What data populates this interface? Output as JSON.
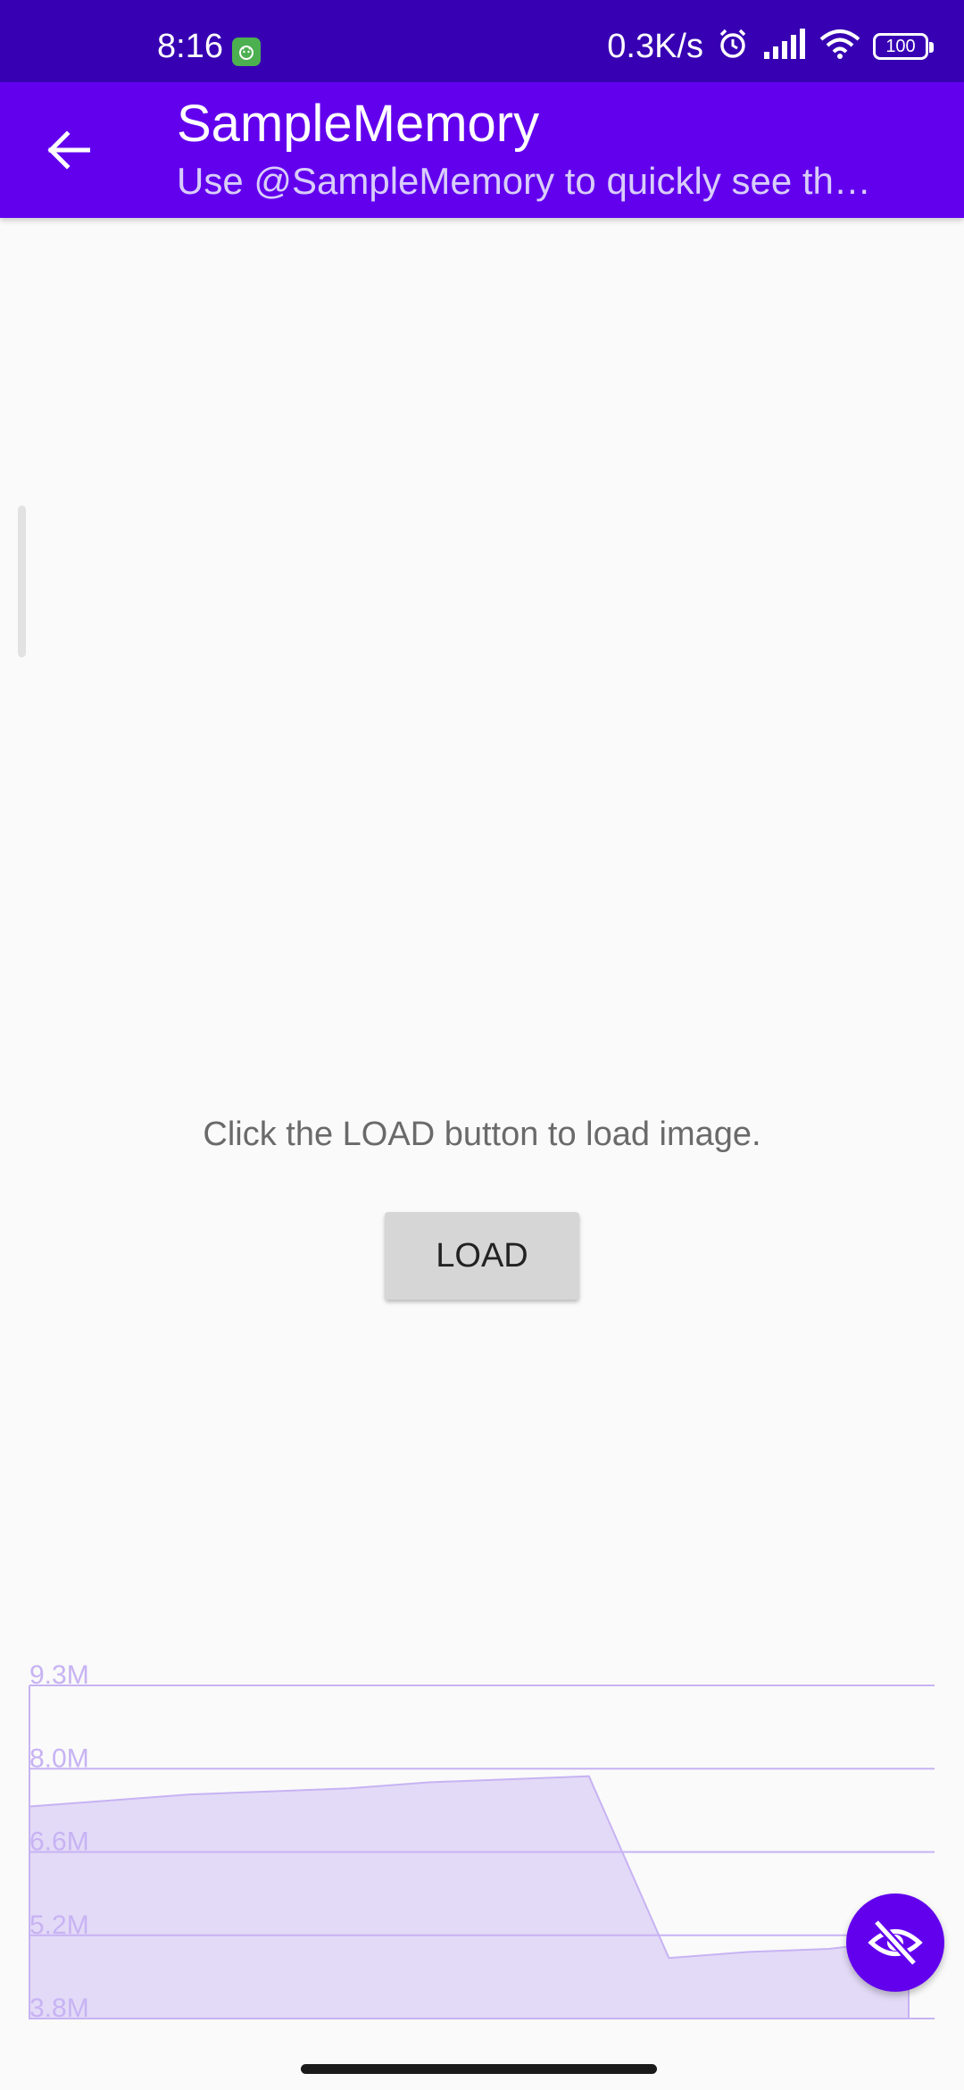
{
  "status_bar": {
    "time": "8:16",
    "network_speed": "0.3K/s",
    "battery": "100",
    "icons": [
      "app-notification-icon",
      "alarm-icon",
      "signal-icon",
      "wifi-icon",
      "battery-icon"
    ]
  },
  "app_bar": {
    "title": "SampleMemory",
    "subtitle": "Use @SampleMemory to quickly see th…",
    "back_icon": "arrow-back-icon",
    "background": "#6200ee"
  },
  "main": {
    "message": "Click the LOAD button to load image.",
    "load_button": "LOAD"
  },
  "chart_data": {
    "type": "area",
    "y_tick_labels": [
      "9.3M",
      "8.0M",
      "6.6M",
      "5.2M",
      "3.8M"
    ],
    "ylim": [
      3.8,
      9.3
    ],
    "unit": "M",
    "grid": true,
    "color": "#c7b3f3",
    "values": [
      7.3,
      7.4,
      7.5,
      7.55,
      7.6,
      7.7,
      7.75,
      7.8,
      4.8,
      4.9,
      4.95,
      5.1
    ]
  },
  "fab": {
    "icon": "visibility-off-icon",
    "color": "#6200ee"
  }
}
